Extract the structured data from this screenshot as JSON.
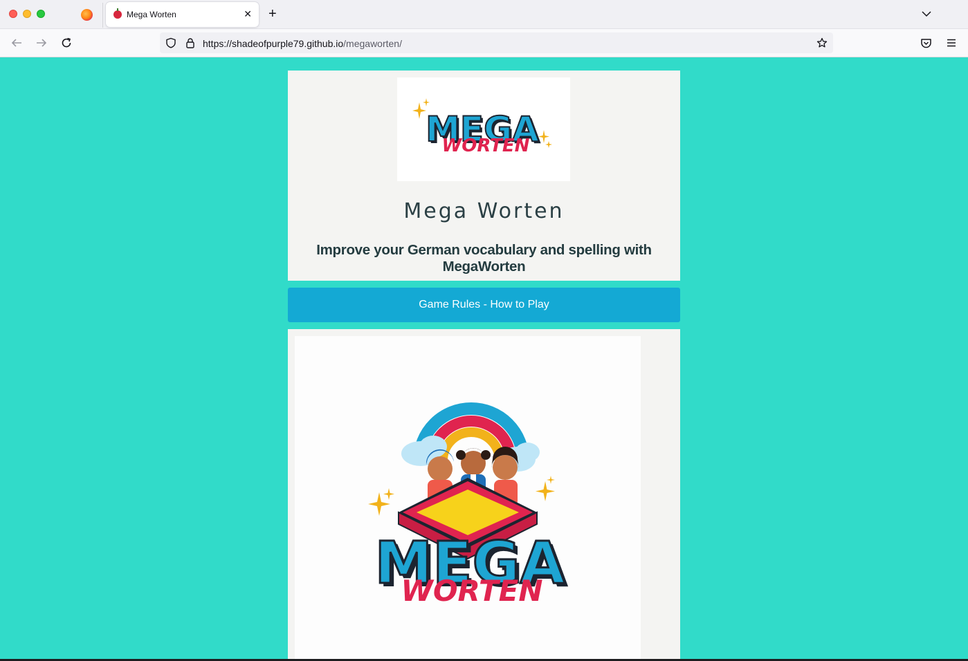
{
  "browser": {
    "tab_title": "Mega Worten",
    "url_host": "https://shadeofpurple79.github.io",
    "url_path": "/megaworten/"
  },
  "header": {
    "logo_text_top": "MEGA",
    "logo_text_bottom": "WORTEN",
    "title": "Mega Worten",
    "subtitle": "Improve your German vocabulary and spelling with MegaWorten"
  },
  "rules_button": {
    "label": "Game Rules - How to Play"
  },
  "hero": {
    "logo_text_top": "MEGA",
    "logo_text_bottom": "WORTEN"
  },
  "colors": {
    "background": "#31dbc9",
    "button": "#14a9d4",
    "logo_blue": "#1ea5d3",
    "logo_red": "#e0244f"
  }
}
